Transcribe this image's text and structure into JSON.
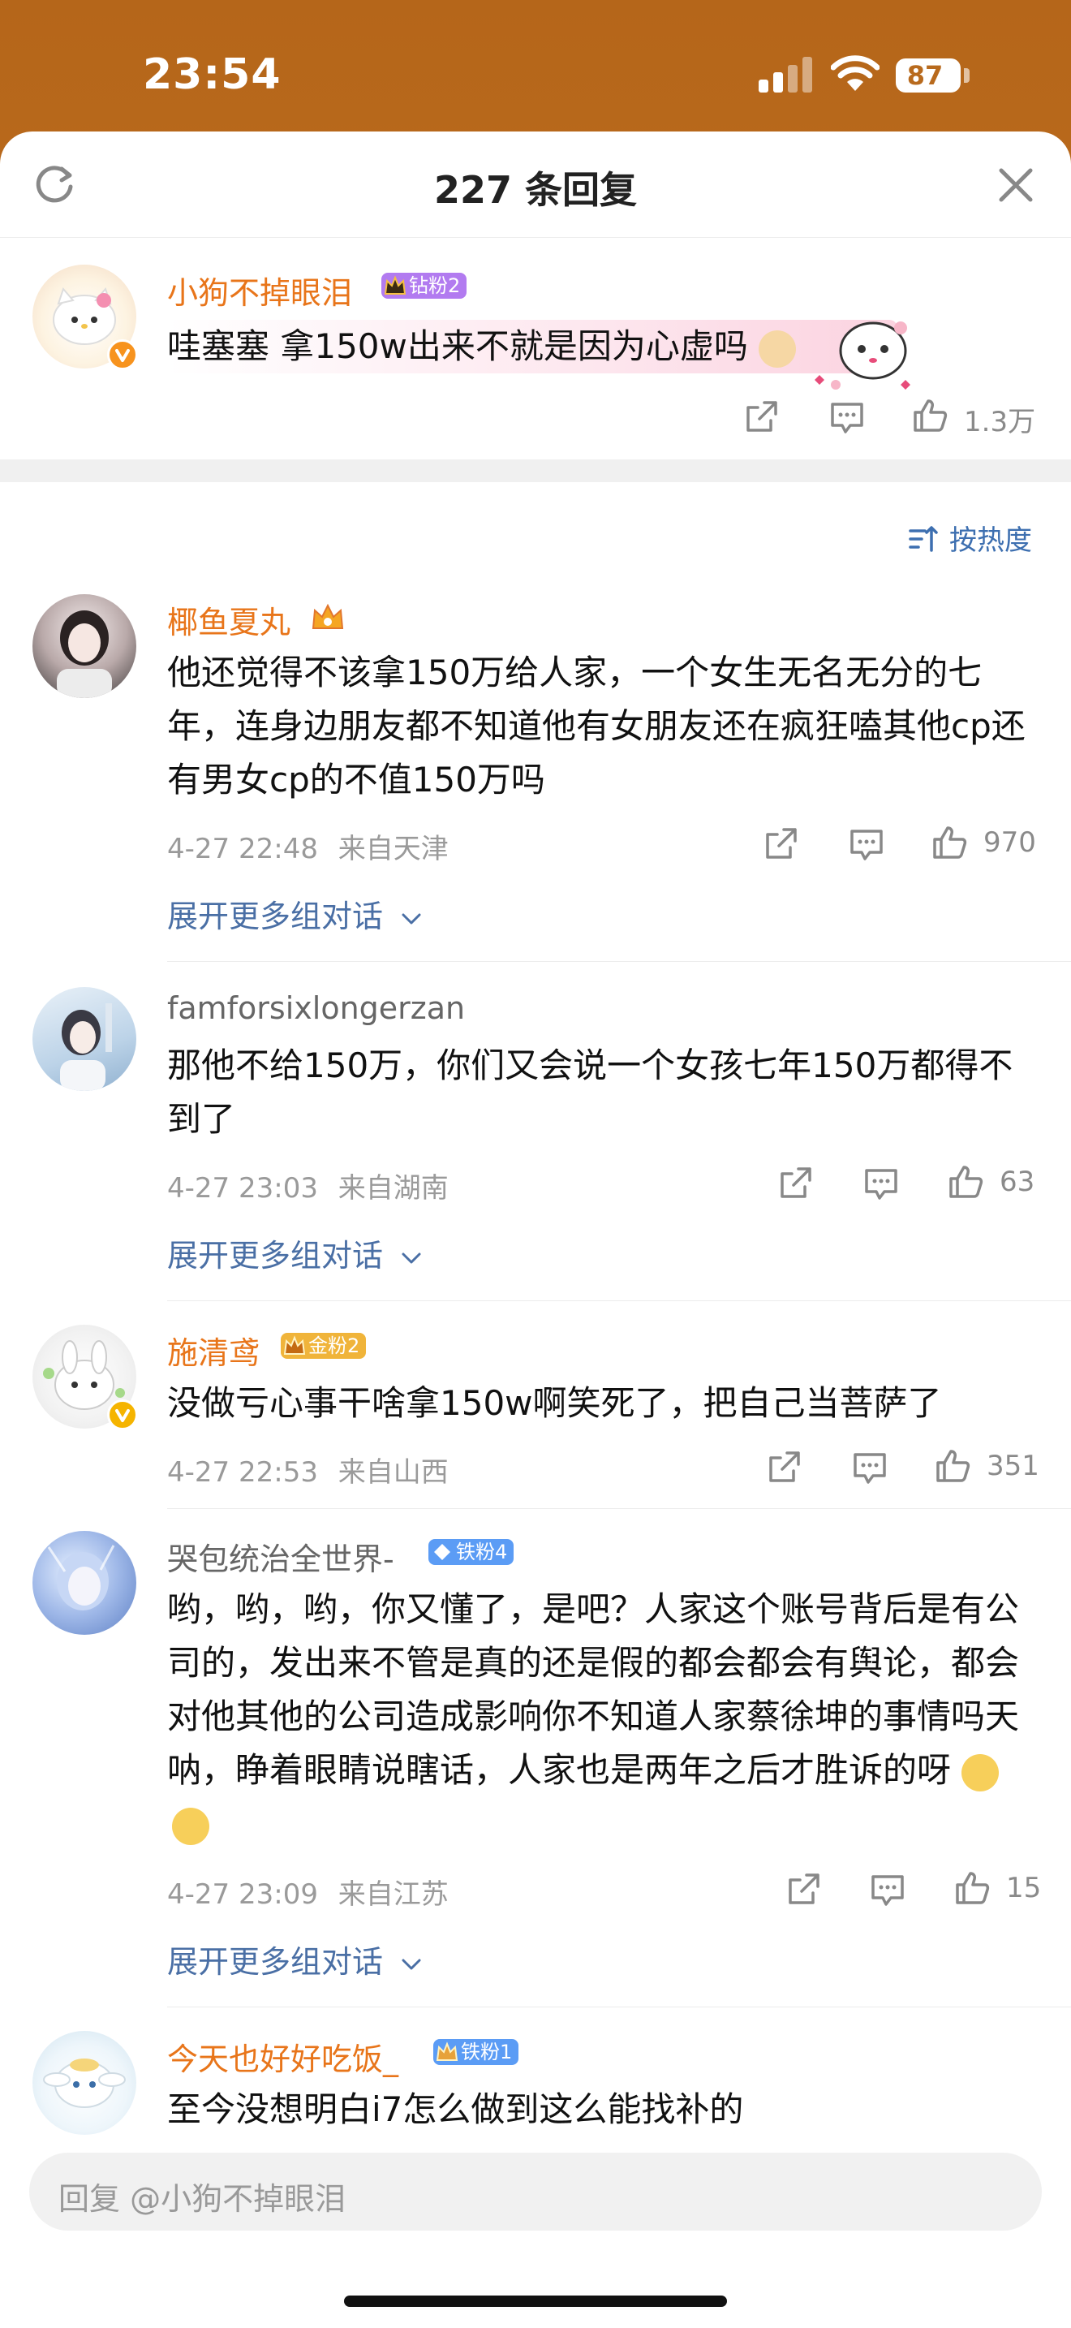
{
  "status": {
    "time": "23:54",
    "battery": "87"
  },
  "header": {
    "title": "227 条回复"
  },
  "root_comment": {
    "username": "小狗不掉眼泪",
    "fan_badge": "钻粉2",
    "text": "哇塞塞 拿150w出来不就是因为心虚吗",
    "likes": "1.3万"
  },
  "sort": {
    "label": "按热度"
  },
  "replies": [
    {
      "username": "椰鱼夏丸",
      "text": "他还觉得不该拿150万给人家，一个女生无名无分的七年，连身边朋友都不知道他有女朋友还在疯狂嗑其他cp还有男女cp的不值150万吗",
      "time": "4-27 22:48",
      "location": "来自天津",
      "likes": "970",
      "expand": "展开更多组对话"
    },
    {
      "username": "famforsixlongerzan",
      "text": "那他不给150万，你们又会说一个女孩七年150万都得不到了",
      "time": "4-27 23:03",
      "location": "来自湖南",
      "likes": "63",
      "expand": "展开更多组对话"
    },
    {
      "username": "施清鸢",
      "fan_badge": "金粉2",
      "text": "没做亏心事干啥拿150w啊笑死了，把自己当菩萨了",
      "time": "4-27 22:53",
      "location": "来自山西",
      "likes": "351"
    },
    {
      "username": "哭包统治全世界-",
      "fan_badge": "铁粉4",
      "text": "哟，哟，哟，你又懂了，是吧？人家这个账号背后是有公司的，发出来不管是真的还是假的都会都会有舆论，都会对他其他的公司造成影响你不知道人家蔡徐坤的事情吗天呐，睁着眼睛说瞎话，人家也是两年之后才胜诉的呀",
      "time": "4-27 23:09",
      "location": "来自江苏",
      "likes": "15",
      "expand": "展开更多组对话"
    },
    {
      "username": "今天也好好吃饭_",
      "fan_badge": "铁粉1",
      "text": "至今没想明白i7怎么做到这么能找补的"
    }
  ],
  "reply_input": {
    "placeholder": "回复 @小狗不掉眼泪"
  },
  "colors": {
    "accent_orange": "#e8751a",
    "link_blue": "#4a6fa5",
    "fan_purple": "#b27bf0",
    "fan_gold": "#f0b43a",
    "fan_blue": "#5b9cf5"
  }
}
